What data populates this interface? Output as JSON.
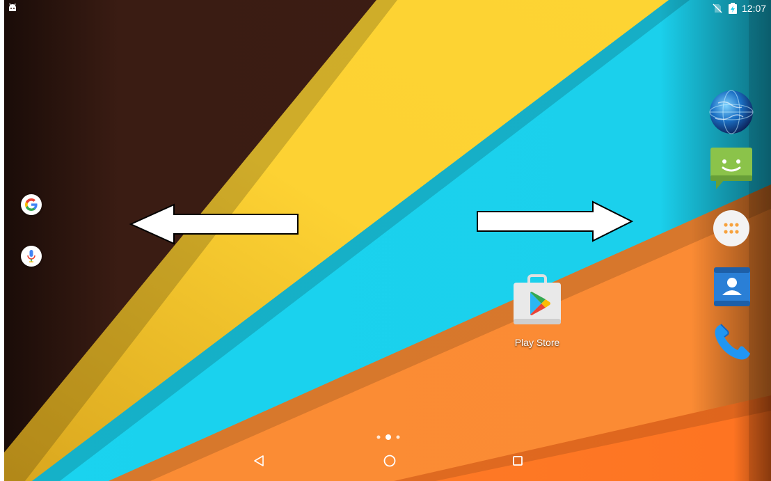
{
  "status_bar": {
    "time": "12:07",
    "icons": [
      "android-debug-icon",
      "no-sim-icon",
      "battery-charging-icon"
    ]
  },
  "search": {
    "google_icon": "google-g-icon",
    "voice_icon": "microphone-icon"
  },
  "gestures": {
    "left_arrow_icon": "arrow-left-icon",
    "right_arrow_icon": "arrow-right-icon"
  },
  "desktop": {
    "shortcuts": [
      {
        "label": "Play Store",
        "icon": "play-store-icon"
      }
    ]
  },
  "dock": {
    "items": [
      {
        "name": "browser",
        "icon": "globe-icon"
      },
      {
        "name": "messaging",
        "icon": "message-smiley-icon"
      },
      {
        "name": "all-apps",
        "icon": "app-drawer-icon"
      },
      {
        "name": "contacts",
        "icon": "contacts-icon"
      },
      {
        "name": "phone",
        "icon": "phone-icon"
      }
    ]
  },
  "page_indicator": {
    "pages": 3,
    "current": 2
  },
  "nav_bar": {
    "buttons": [
      "back-icon",
      "home-icon",
      "recents-icon"
    ]
  },
  "colors": {
    "wallpaper_brown": "#3a1c13",
    "wallpaper_yellow": "#fdd233",
    "wallpaper_cyan": "#1ad3ef",
    "wallpaper_orange": "#fb8c34",
    "wallpaper_deep_orange": "#fe7422"
  }
}
